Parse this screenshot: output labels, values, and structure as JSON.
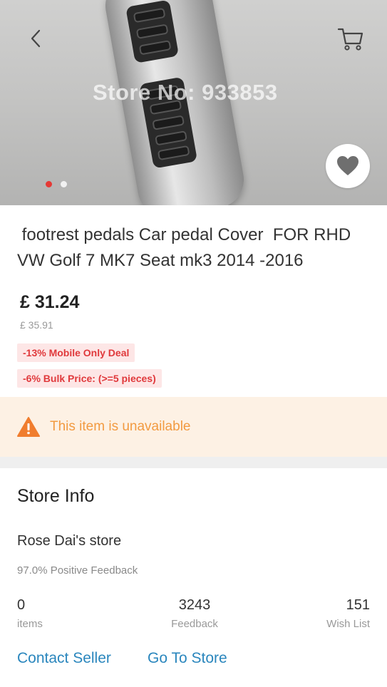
{
  "hero": {
    "watermark": "Store No: 933853",
    "image_count": 2,
    "active_image": 1
  },
  "product": {
    "title": " footrest pedals Car pedal Cover  FOR RHD VW Golf 7 MK7 Seat mk3 2014 -2016",
    "price": "£ 31.24",
    "original_price": "£ 35.91",
    "badges": [
      "-13% Mobile Only Deal",
      "-6% Bulk Price: (>=5 pieces)"
    ]
  },
  "notice": {
    "text": "This item is unavailable",
    "color": "#f29a40"
  },
  "store": {
    "section_title": "Store Info",
    "name": "Rose Dai's store",
    "feedback_text": "97.0% Positive Feedback",
    "stats": [
      {
        "value": "0",
        "label": "items"
      },
      {
        "value": "3243",
        "label": "Feedback"
      },
      {
        "value": "151",
        "label": "Wish List"
      }
    ],
    "contact_label": "Contact Seller",
    "go_store_label": "Go To Store"
  },
  "icons": {
    "back": "chevron-left-icon",
    "cart": "cart-icon",
    "wishlist": "heart-icon",
    "warning": "warning-icon"
  },
  "colors": {
    "accent_red": "#e53935",
    "link_blue": "#2a86bd",
    "notice_bg": "#fdf1e4"
  }
}
